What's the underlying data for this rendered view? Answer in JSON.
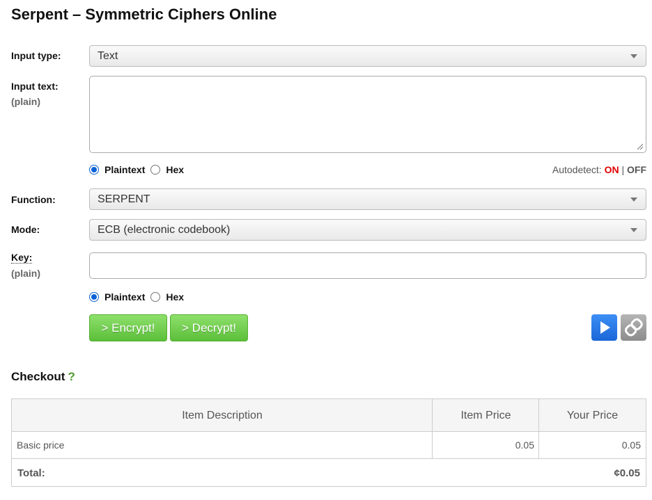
{
  "title": "Serpent – Symmetric Ciphers Online",
  "input_type": {
    "label": "Input type:",
    "value": "Text"
  },
  "input_text": {
    "label": "Input text:",
    "sublabel": "(plain)",
    "value": ""
  },
  "input_format": {
    "options": [
      "Plaintext",
      "Hex"
    ],
    "selected": "Plaintext"
  },
  "autodetect": {
    "label": "Autodetect:",
    "on": "ON",
    "sep": "|",
    "off": "OFF"
  },
  "function": {
    "label": "Function:",
    "value": "SERPENT"
  },
  "mode": {
    "label": "Mode:",
    "value": "ECB (electronic codebook)"
  },
  "key": {
    "label": "Key:",
    "sublabel": "(plain)",
    "value": ""
  },
  "key_format": {
    "options": [
      "Plaintext",
      "Hex"
    ],
    "selected": "Plaintext"
  },
  "buttons": {
    "encrypt": "> Encrypt!",
    "decrypt": "> Decrypt!"
  },
  "icons": {
    "run": "play-icon",
    "link": "link-icon"
  },
  "checkout": {
    "title": "Checkout",
    "help": "?",
    "columns": [
      "Item Description",
      "Item Price",
      "Your Price"
    ],
    "rows": [
      {
        "description": "Basic price",
        "item_price": "0.05",
        "your_price": "0.05"
      }
    ],
    "total_label": "Total:",
    "total_value": "¢0.05"
  },
  "colors": {
    "accent_blue": "#1a66d8",
    "button_green": "#5cbf3a",
    "autodetect_on": "#e00000",
    "help_green": "#4f9a2e"
  }
}
